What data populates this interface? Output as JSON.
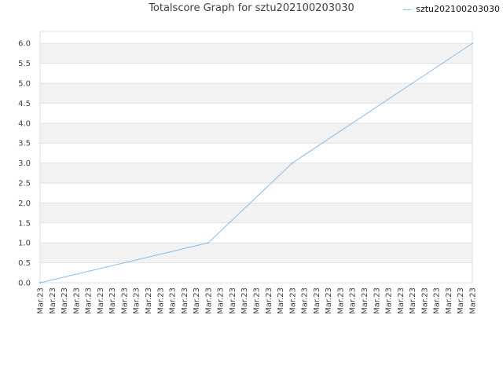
{
  "chart_data": {
    "type": "line",
    "title": "Totalscore Graph for sztu202100203030",
    "xlabel": "",
    "ylabel": "",
    "categories": [
      "Mar.23",
      "Mar.23",
      "Mar.23",
      "Mar.23",
      "Mar.23",
      "Mar.23",
      "Mar.23",
      "Mar.23",
      "Mar.23",
      "Mar.23",
      "Mar.23",
      "Mar.23",
      "Mar.23",
      "Mar.23",
      "Mar.23",
      "Mar.23",
      "Mar.23",
      "Mar.23",
      "Mar.23",
      "Mar.23",
      "Mar.23",
      "Mar.23",
      "Mar.23",
      "Mar.23",
      "Mar.23",
      "Mar.23",
      "Mar.23",
      "Mar.23",
      "Mar.23",
      "Mar.23",
      "Mar.23",
      "Mar.23",
      "Mar.23",
      "Mar.23",
      "Mar.23",
      "Mar.23",
      "Mar.23"
    ],
    "series": [
      {
        "name": "sztu202100203030",
        "color": "#82bdf0",
        "values": [
          0,
          1,
          3,
          6
        ],
        "x_index": [
          0,
          14,
          21,
          36
        ]
      }
    ],
    "ylim": [
      0,
      6.3
    ],
    "yticks": [
      "0.0",
      "0.5",
      "1.0",
      "1.5",
      "2.0",
      "2.5",
      "3.0",
      "3.5",
      "4.0",
      "4.5",
      "5.0",
      "5.5",
      "6.0"
    ],
    "grid": true,
    "band_colors": [
      "#ffffff",
      "#f2f2f2"
    ],
    "legend_position": "top-right"
  }
}
